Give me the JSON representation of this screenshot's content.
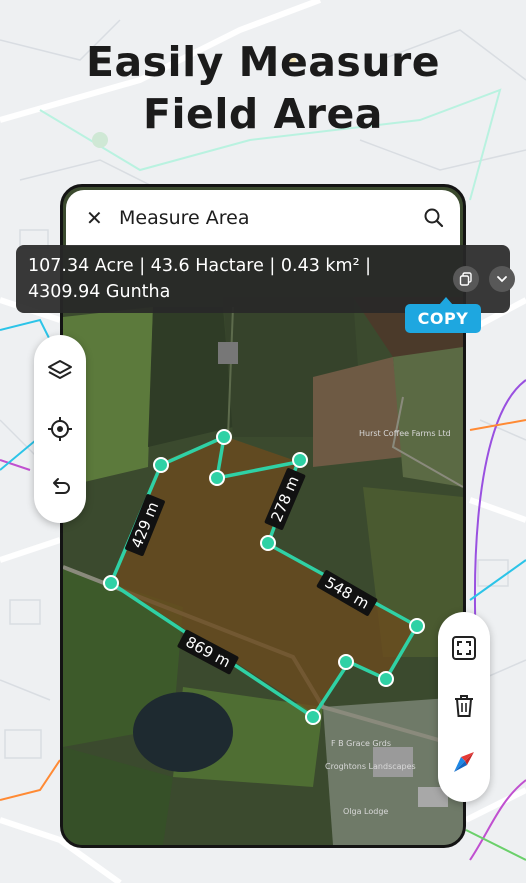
{
  "headline": {
    "line1": "Easily Measure",
    "line2": "Field Area"
  },
  "search_bar": {
    "close_icon": "close-icon",
    "title": "Measure Area",
    "search_icon": "search-icon"
  },
  "result": {
    "line1": "107.34 Acre | 43.6 Hactare | 0.43 km² |",
    "line2": "4309.94 Guntha",
    "copy_label": "COPY"
  },
  "measurements": {
    "left_side": "429 m",
    "inner_side": "278 m",
    "right_side": "548 m",
    "bottom_side": "869 m"
  },
  "map_labels": {
    "farm": "Hurst Coffee Farms Ltd",
    "landscapes": "Croghtons Landscapes",
    "market": "Olga Lodge",
    "garden": "F B Grace Grds"
  },
  "colors": {
    "polygon_stroke": "#2fd1a5",
    "polygon_fill": "#6b4a1e",
    "copy_badge": "#1ea7e0"
  }
}
